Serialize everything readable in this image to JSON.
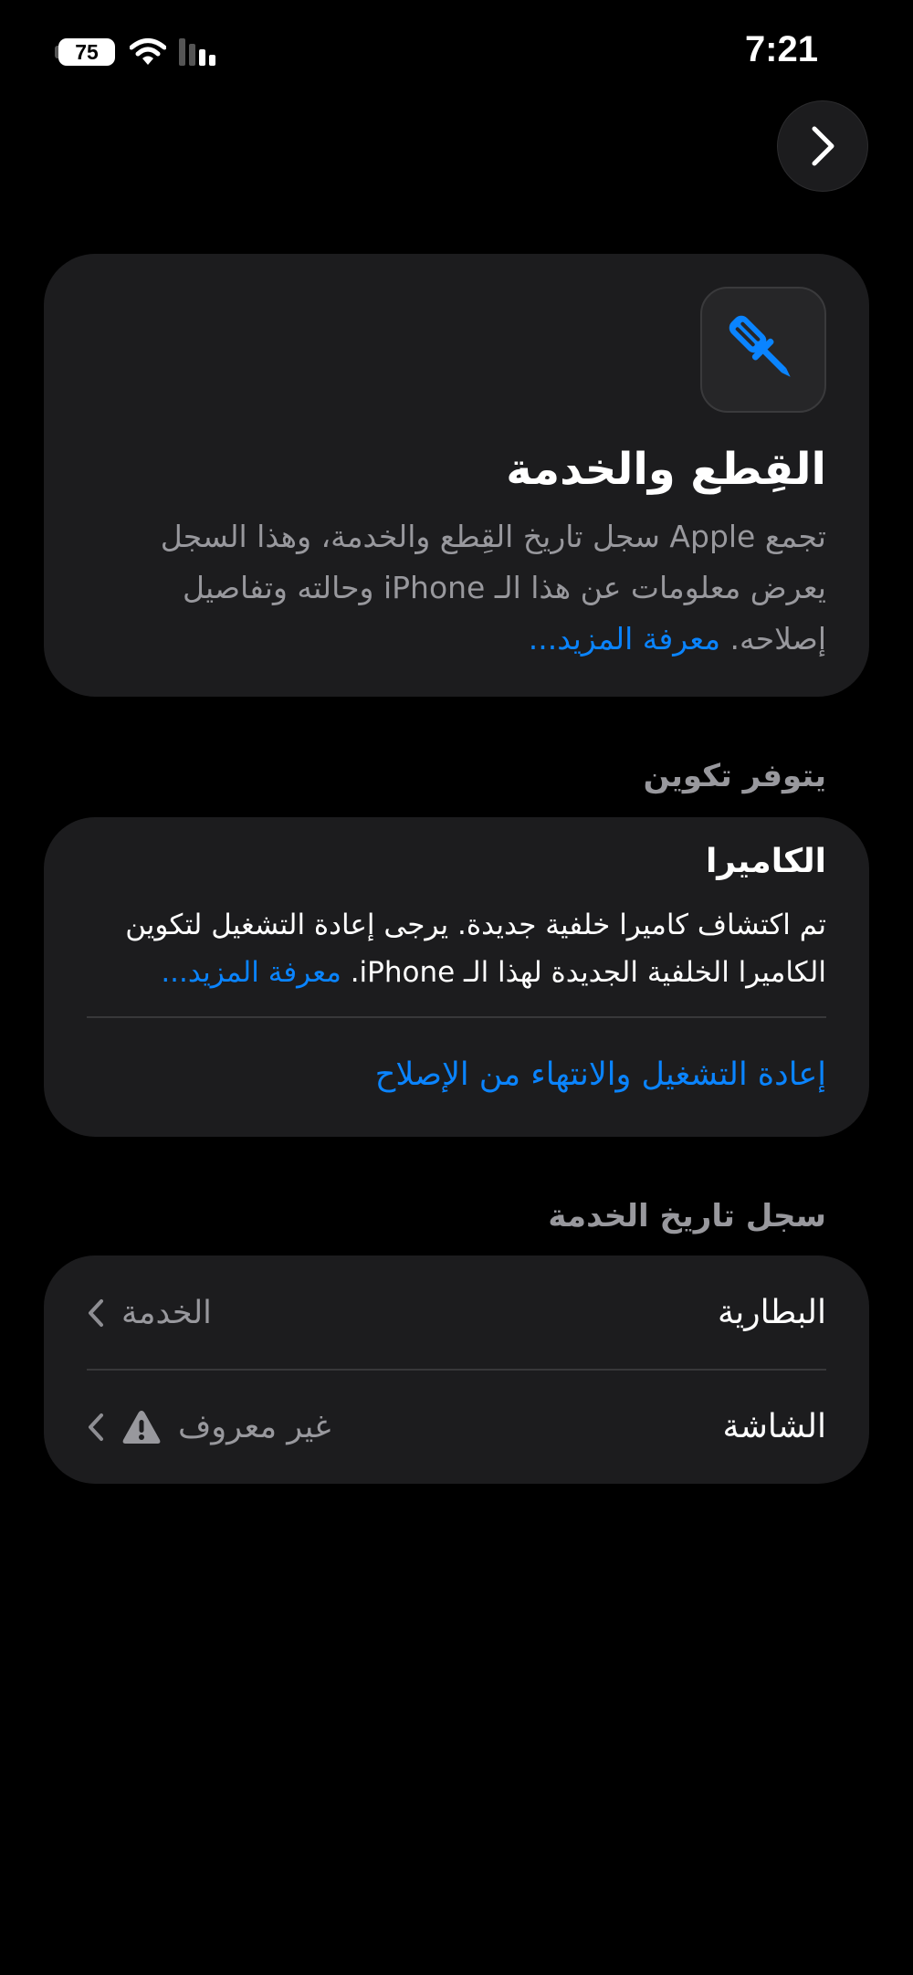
{
  "status_bar": {
    "battery_level": "75",
    "time": "7:21",
    "icons": [
      "battery-icon",
      "wifi-icon",
      "cellular-signal-icon"
    ]
  },
  "navigation": {
    "next_icon": "chevron-right-icon"
  },
  "intro": {
    "icon": "screwdriver-icon",
    "title": "القِطع والخدمة",
    "body": "تجمع Apple سجل تاريخ القِطع والخدمة، وهذا السجل يعرض معلومات عن هذا الـ iPhone وحالته وتفاصيل إصلاحه.",
    "learn_more": "معرفة المزيد..."
  },
  "configuration": {
    "section_title": "يتوفر تكوين",
    "camera_title": "الكاميرا",
    "camera_body": "تم اكتشاف كاميرا خلفية جديدة. يرجى إعادة التشغيل لتكوين الكاميرا الخلفية الجديدة لهذا الـ iPhone.",
    "learn_more": "معرفة المزيد...",
    "restart_action": "إعادة التشغيل والانتهاء من الإصلاح"
  },
  "service_history": {
    "section_title": "سجل تاريخ الخدمة",
    "rows": [
      {
        "label": "البطارية",
        "status": "الخدمة",
        "icon": "chevron-left-icon"
      },
      {
        "label": "الشاشة",
        "status": "غير معروف",
        "icon": "warning-icon"
      }
    ]
  },
  "colors": {
    "background": "#000000",
    "card": "#1c1c1e",
    "accent_blue": "#0a84ff",
    "secondary_text": "#98989d",
    "separator": "#38383a"
  }
}
